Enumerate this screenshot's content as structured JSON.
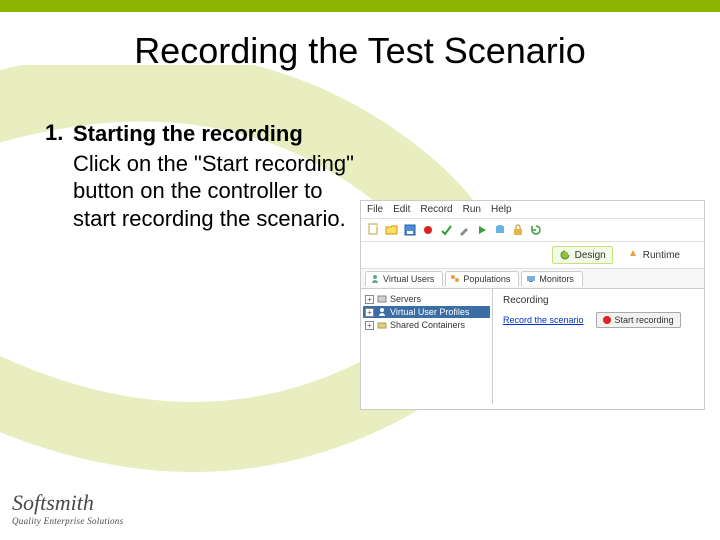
{
  "slide": {
    "title": "Recording the Test Scenario"
  },
  "step": {
    "number": "1.",
    "heading": "Starting the recording",
    "body": "Click on the \"Start recording\" button on the controller to start recording the scenario."
  },
  "screenshot": {
    "menubar": [
      "File",
      "Edit",
      "Record",
      "Run",
      "Help"
    ],
    "modes": {
      "design": "Design",
      "runtime": "Runtime"
    },
    "tabs": {
      "virtual_users": "Virtual Users",
      "populations": "Populations",
      "monitors": "Monitors"
    },
    "tree": {
      "servers": "Servers",
      "virtual_user_profiles": "Virtual User Profiles",
      "shared_containers": "Shared Containers"
    },
    "right": {
      "section": "Recording",
      "record_scenario_link": "Record the scenario",
      "start_recording_btn": "Start recording"
    }
  },
  "logo": {
    "name": "Softsmith",
    "tag": "Quality Enterprise Solutions"
  }
}
